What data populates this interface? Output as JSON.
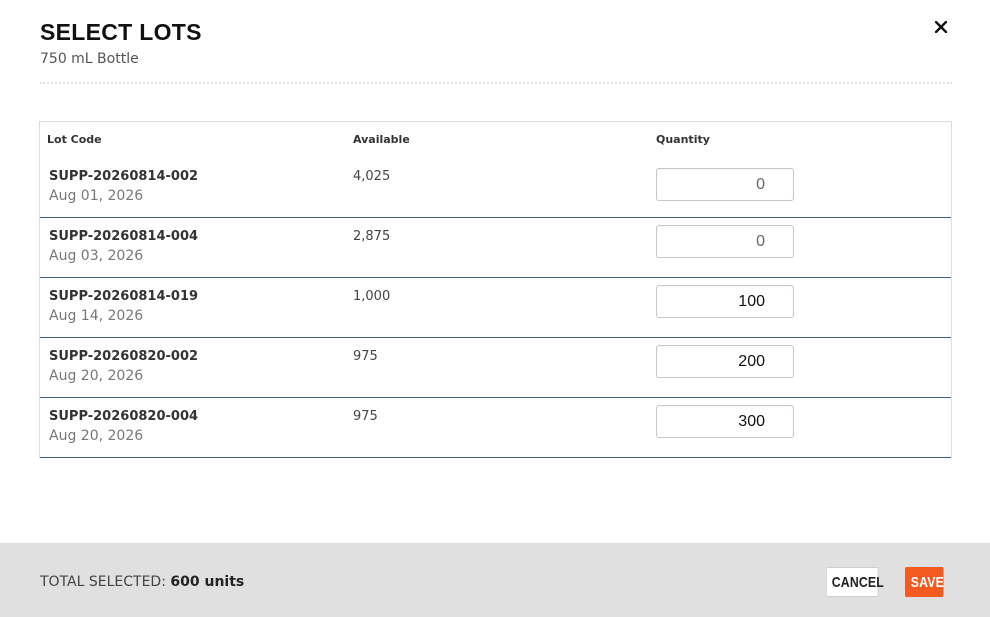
{
  "modal": {
    "title": "SELECT LOTS",
    "subtitle": "750 mL Bottle",
    "close_label": "close"
  },
  "table": {
    "headers": {
      "lot_code": "Lot Code",
      "available": "Available",
      "quantity": "Quantity"
    },
    "rows": [
      {
        "lot_code": "SUPP-20260814-002",
        "date": "Aug 01, 2026",
        "available": "4,025",
        "quantity": "0"
      },
      {
        "lot_code": "SUPP-20260814-004",
        "date": "Aug 03, 2026",
        "available": "2,875",
        "quantity": "0"
      },
      {
        "lot_code": "SUPP-20260814-019",
        "date": "Aug 14, 2026",
        "available": "1,000",
        "quantity": "100"
      },
      {
        "lot_code": "SUPP-20260820-002",
        "date": "Aug 20, 2026",
        "available": "975",
        "quantity": "200"
      },
      {
        "lot_code": "SUPP-20260820-004",
        "date": "Aug 20, 2026",
        "available": "975",
        "quantity": "300"
      }
    ]
  },
  "footer": {
    "total_label": "TOTAL SELECTED:",
    "total_value": "600 units",
    "cancel_label": "Cancel",
    "save_label": "Save"
  },
  "colors": {
    "accent": "#f25a1f",
    "row_divider": "#3e5f82",
    "footer_bg": "#e0e0e0"
  },
  "icons": {
    "close": "close-icon"
  }
}
